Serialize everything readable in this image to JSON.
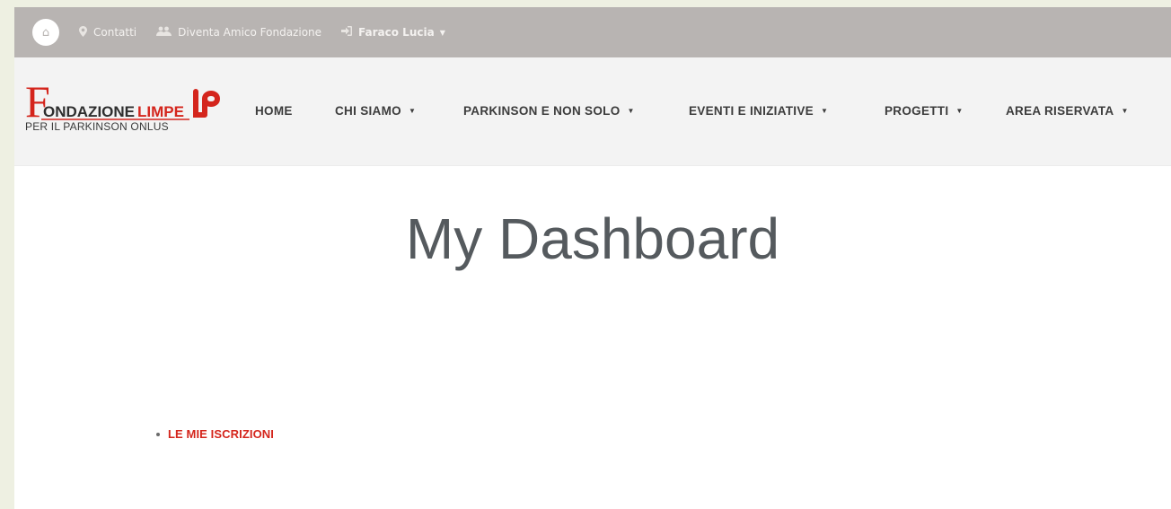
{
  "topbar": {
    "home_icon": "home-icon",
    "links": [
      {
        "label": "Contatti",
        "icon": "map-marker-icon"
      },
      {
        "label": "Diventa Amico Fondazione",
        "icon": "users-icon"
      },
      {
        "label": "Faraco Lucia",
        "icon": "sign-in-icon"
      }
    ]
  },
  "logo": {
    "first_letter": "F",
    "word1": "ONDAZIONE",
    "word2": "LIMPE",
    "tagline": "PER IL PARKINSON ONLUS",
    "monogram": "LP"
  },
  "nav": {
    "items": [
      {
        "label": "HOME",
        "dropdown": false
      },
      {
        "label": "CHI SIAMO",
        "dropdown": true
      },
      {
        "label": "PARKINSON E NON SOLO",
        "dropdown": true
      },
      {
        "label": "EVENTI E INIZIATIVE",
        "dropdown": true
      },
      {
        "label": "PROGETTI",
        "dropdown": true
      },
      {
        "label": "AREA RISERVATA",
        "dropdown": true
      }
    ]
  },
  "main": {
    "title": "My Dashboard",
    "links": [
      {
        "label": "LE MIE ISCRIZIONI"
      }
    ]
  },
  "colors": {
    "topbar_bg": "#b8b4b2",
    "navbar_bg": "#f3f3f3",
    "brand_red": "#d4251c",
    "title_text": "#555a5e"
  }
}
